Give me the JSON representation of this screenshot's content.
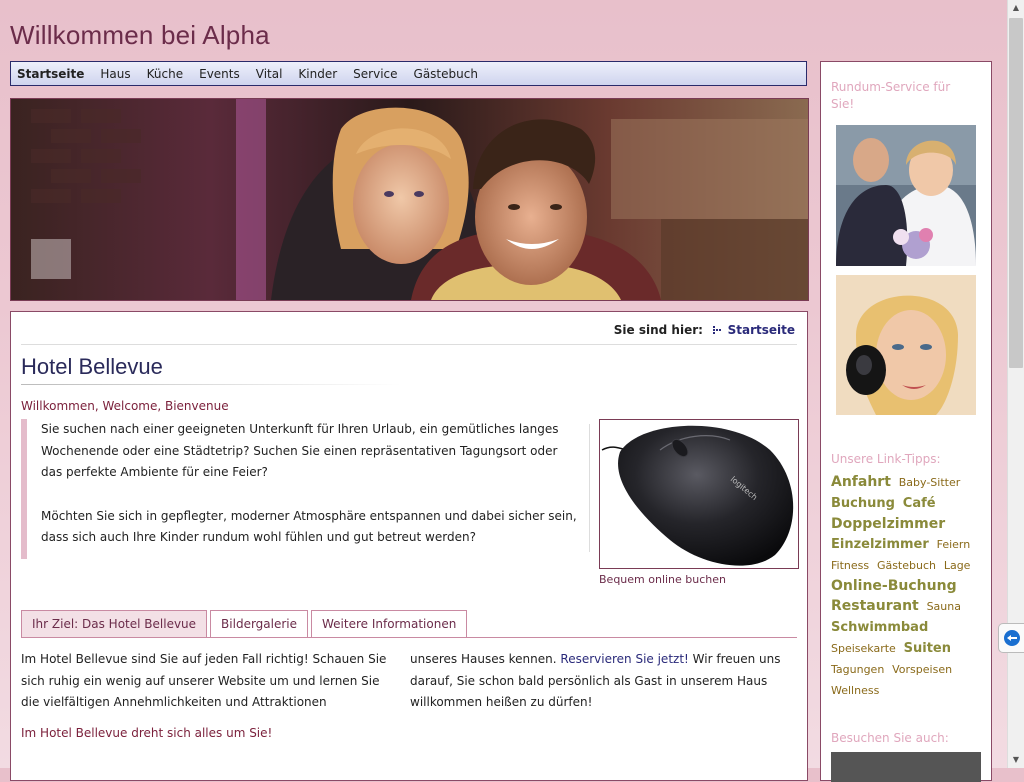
{
  "site": {
    "title": "Willkommen bei Alpha"
  },
  "nav": {
    "items": [
      {
        "label": "Startseite"
      },
      {
        "label": "Haus"
      },
      {
        "label": "Küche"
      },
      {
        "label": "Events"
      },
      {
        "label": "Vital"
      },
      {
        "label": "Kinder"
      },
      {
        "label": "Service"
      },
      {
        "label": "Gästebuch"
      }
    ]
  },
  "breadcrumb": {
    "label": "Sie sind hier:",
    "current": "Startseite"
  },
  "main": {
    "heading": "Hotel Bellevue",
    "welcome": "Willkommen, Welcome, Bienvenue",
    "intro_p1": "Sie suchen nach einer geeigneten Unterkunft für Ihren Urlaub, ein gemütliches langes Wochenende oder eine Städtetrip? Suchen Sie einen repräsentativen Tagungsort oder das perfekte Ambiente für eine Feier?",
    "intro_p2": "Möchten Sie sich in gepflegter, moderner Atmosphäre entspannen und dabei sicher sein, dass sich auch Ihre Kinder rundum wohl fühlen und gut betreut werden?",
    "image_caption": "Bequem online buchen",
    "tabs": [
      {
        "label": "Ihr Ziel: Das Hotel Bellevue"
      },
      {
        "label": "Bildergalerie"
      },
      {
        "label": "Weitere Informationen"
      }
    ],
    "col_left": "Im Hotel Bellevue sind Sie auf jeden Fall richtig! Schauen Sie sich ruhig ein wenig auf unserer Website um und lernen Sie die vielfältigen Annehmlichkeiten und Attraktionen",
    "col_right_before": "unseres Hauses kennen.",
    "col_right_link": "Reservieren Sie jetzt!",
    "col_right_after": "Wir freuen uns darauf, Sie schon bald persönlich als Gast in unserem Haus willkommen heißen zu dürfen!",
    "closing": "Im Hotel Bellevue dreht sich alles um Sie!"
  },
  "sidebar": {
    "heading1": "Rundum-Service für Sie!",
    "heading2": "Unsere Link-Tipps:",
    "heading3": "Besuchen Sie auch:",
    "tags": [
      {
        "label": "Anfahrt",
        "size": "l"
      },
      {
        "label": "Baby-Sitter",
        "size": "s"
      },
      {
        "label": "Buchung",
        "size": "m"
      },
      {
        "label": "Café",
        "size": "m"
      },
      {
        "label": "Doppelzimmer",
        "size": "l"
      },
      {
        "label": "Einzelzimmer",
        "size": "m"
      },
      {
        "label": "Feiern",
        "size": "s"
      },
      {
        "label": "Fitness",
        "size": "s"
      },
      {
        "label": "Gästebuch",
        "size": "s"
      },
      {
        "label": "Lage",
        "size": "s"
      },
      {
        "label": "Online-Buchung",
        "size": "l"
      },
      {
        "label": "Restaurant",
        "size": "l"
      },
      {
        "label": "Sauna",
        "size": "s"
      },
      {
        "label": "Schwimmbad",
        "size": "m"
      },
      {
        "label": "Speisekarte",
        "size": "s"
      },
      {
        "label": "Suiten",
        "size": "m"
      },
      {
        "label": "Tagungen",
        "size": "s"
      },
      {
        "label": "Vorspeisen",
        "size": "s"
      },
      {
        "label": "Wellness",
        "size": "s"
      }
    ]
  },
  "colors": {
    "brand": "#6b2c4a",
    "nav_border": "#2a2a6a",
    "tag": "#8a8a3a",
    "sidebar_heading": "#e0a7bd"
  },
  "icons": {
    "breadcrumb": "breadcrumb-dots-icon",
    "scroll_up": "scroll-up-arrow-icon",
    "scroll_down": "scroll-down-arrow-icon",
    "remote_widget": "remote-support-icon"
  }
}
